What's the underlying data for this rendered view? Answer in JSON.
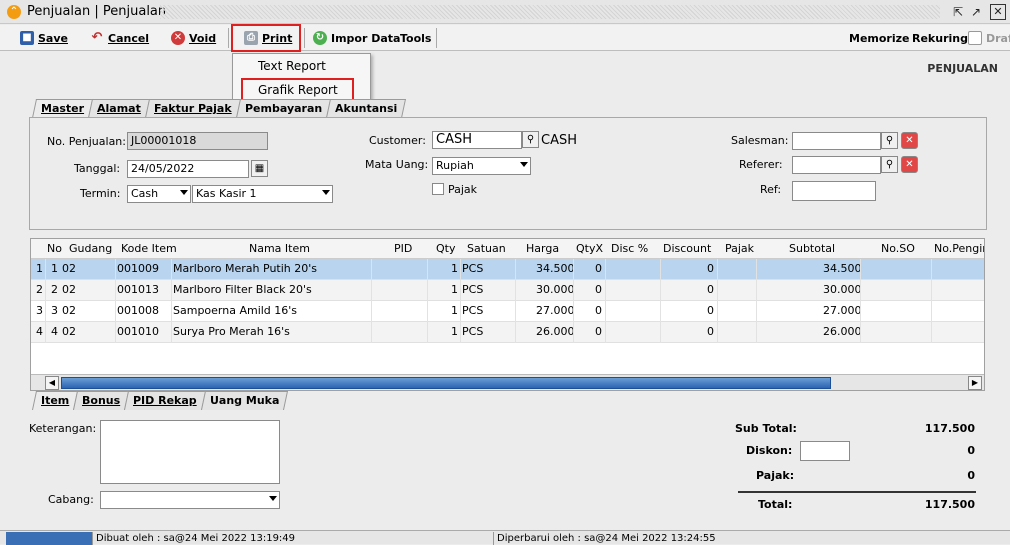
{
  "window": {
    "title": "Penjualan | Penjualan"
  },
  "toolbar": {
    "save": "Save",
    "cancel": "Cancel",
    "void": "Void",
    "print": "Print",
    "impor": "Impor Data",
    "tools": "Tools",
    "memorize": "Memorize",
    "rekuring": "Rekuring",
    "draft": "Draft"
  },
  "print_menu": {
    "items": [
      "Text Report",
      "Grafik Report"
    ]
  },
  "section_title": "PENJUALAN",
  "tabs_top": [
    "Master",
    "Alamat",
    "Faktur Pajak",
    "Pembayaran",
    "Akuntansi"
  ],
  "form": {
    "no_penjualan_label": "No. Penjualan:",
    "no_penjualan": "JL00001018",
    "tanggal_label": "Tanggal:",
    "tanggal": "24/05/2022",
    "termin_label": "Termin:",
    "termin": "Cash",
    "kas": "Kas Kasir 1",
    "customer_label": "Customer:",
    "customer": "CASH",
    "customer_name": "CASH",
    "mata_uang_label": "Mata Uang:",
    "mata_uang": "Rupiah",
    "pajak_label": "Pajak",
    "salesman_label": "Salesman:",
    "referer_label": "Referer:",
    "ref_label": "Ref:"
  },
  "grid": {
    "headers": [
      "No",
      "Gudang",
      "Kode Item",
      "Nama Item",
      "PID",
      "Qty",
      "Satuan",
      "Harga",
      "QtyX",
      "Disc %",
      "Discount",
      "Pajak",
      "Subtotal",
      "No.SO",
      "No.Pengiri"
    ],
    "rows": [
      {
        "idx": "1",
        "no": "1",
        "gudang": "02",
        "kode": "001009",
        "nama": "Marlboro Merah Putih 20's",
        "qty": "1",
        "satuan": "PCS",
        "harga": "34.500",
        "qtyx": "0",
        "discount": "0",
        "subtotal": "34.500"
      },
      {
        "idx": "2",
        "no": "2",
        "gudang": "02",
        "kode": "001013",
        "nama": "Marlboro Filter Black 20's",
        "qty": "1",
        "satuan": "PCS",
        "harga": "30.000",
        "qtyx": "0",
        "discount": "0",
        "subtotal": "30.000"
      },
      {
        "idx": "3",
        "no": "3",
        "gudang": "02",
        "kode": "001008",
        "nama": "Sampoerna Amild 16's",
        "qty": "1",
        "satuan": "PCS",
        "harga": "27.000",
        "qtyx": "0",
        "discount": "0",
        "subtotal": "27.000"
      },
      {
        "idx": "4",
        "no": "4",
        "gudang": "02",
        "kode": "001010",
        "nama": "Surya Pro Merah 16's",
        "qty": "1",
        "satuan": "PCS",
        "harga": "26.000",
        "qtyx": "0",
        "discount": "0",
        "subtotal": "26.000"
      }
    ]
  },
  "tabs_bottom": [
    "Item",
    "Bonus",
    "PID Rekap",
    "Uang Muka"
  ],
  "footer": {
    "keterangan_label": "Keterangan:",
    "cabang_label": "Cabang:",
    "sub_total_label": "Sub Total:",
    "sub_total": "117.500",
    "diskon_label": "Diskon:",
    "diskon": "0",
    "pajak_label": "Pajak:",
    "pajak": "0",
    "total_label": "Total:",
    "total": "117.500"
  },
  "status": {
    "created": "Dibuat oleh : sa@24 Mei 2022  13:19:49",
    "updated": "Diperbarui oleh : sa@24 Mei 2022  13:24:55"
  },
  "colors": {
    "highlight": "#e02020",
    "selected_row": "#b8d4ee",
    "scroll_thumb": "#2c64b0"
  }
}
